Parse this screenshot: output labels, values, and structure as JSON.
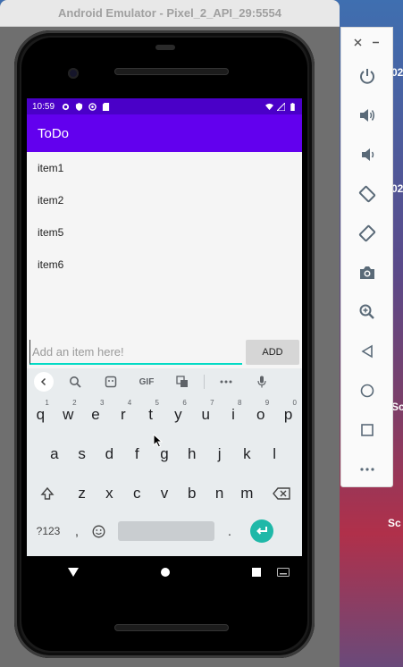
{
  "desktop": {
    "side_text_1": "02",
    "side_text_2": "02",
    "side_text_3": "Sc",
    "side_text_4": "Sc"
  },
  "window": {
    "title": "Android Emulator - Pixel_2_API_29:5554"
  },
  "status_bar": {
    "time": "10:59"
  },
  "app": {
    "title": "ToDo",
    "items": [
      "item1",
      "item2",
      "item5",
      "item6"
    ],
    "input_placeholder": "Add an item here!",
    "input_value": "",
    "add_label": "ADD"
  },
  "keyboard": {
    "toolbar": {
      "gif_label": "GIF"
    },
    "row1": [
      {
        "k": "q",
        "n": "1"
      },
      {
        "k": "w",
        "n": "2"
      },
      {
        "k": "e",
        "n": "3"
      },
      {
        "k": "r",
        "n": "4"
      },
      {
        "k": "t",
        "n": "5"
      },
      {
        "k": "y",
        "n": "6"
      },
      {
        "k": "u",
        "n": "7"
      },
      {
        "k": "i",
        "n": "8"
      },
      {
        "k": "o",
        "n": "9"
      },
      {
        "k": "p",
        "n": "0"
      }
    ],
    "row2": [
      "a",
      "s",
      "d",
      "f",
      "g",
      "h",
      "j",
      "k",
      "l"
    ],
    "row3": [
      "z",
      "x",
      "c",
      "v",
      "b",
      "n",
      "m"
    ],
    "symbols_label": "?123",
    "comma": ",",
    "period": "."
  },
  "colors": {
    "primary": "#6200ee",
    "status": "#4a00c8",
    "accent": "#03dac5",
    "enter": "#1fb8a8"
  },
  "side_panel": {
    "icons": [
      "power-icon",
      "volume-up-icon",
      "volume-down-icon",
      "rotate-left-icon",
      "rotate-right-icon",
      "camera-icon",
      "zoom-icon",
      "back-icon",
      "home-icon",
      "overview-icon",
      "more-icon"
    ]
  }
}
